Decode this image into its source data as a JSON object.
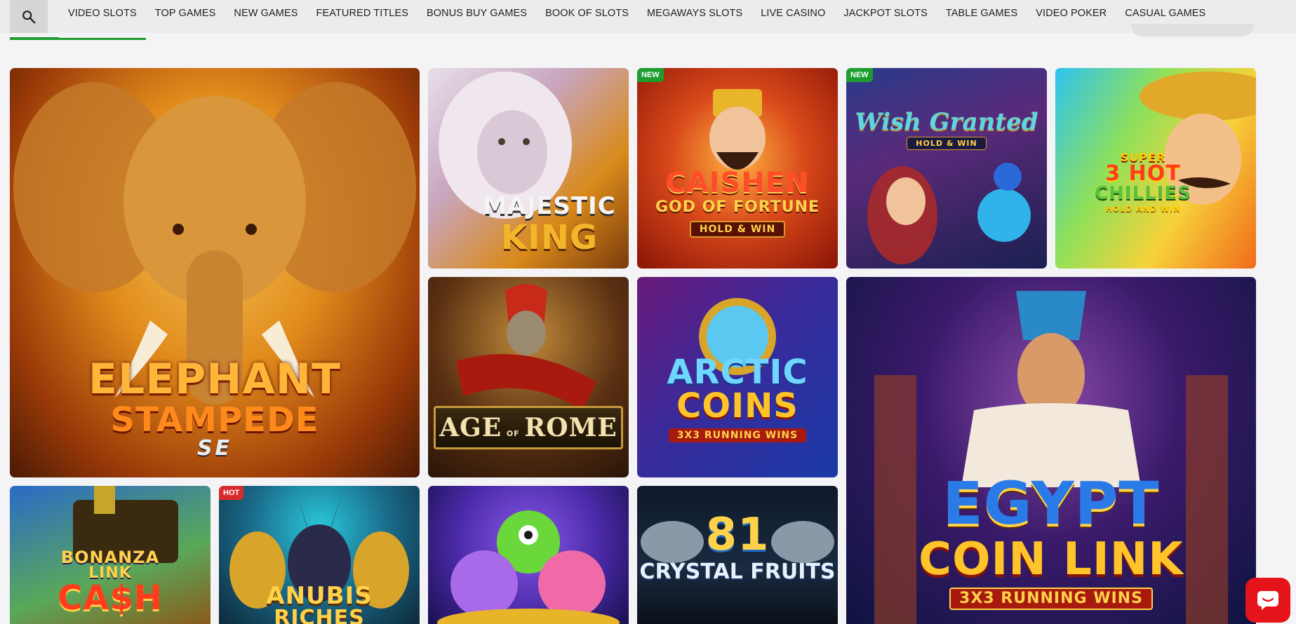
{
  "nav": {
    "tabs": [
      {
        "label": "VIDEO SLOTS",
        "active": true
      },
      {
        "label": "TOP GAMES"
      },
      {
        "label": "NEW GAMES"
      },
      {
        "label": "FEATURED TITLES"
      },
      {
        "label": "BONUS BUY GAMES"
      },
      {
        "label": "BOOK OF SLOTS"
      },
      {
        "label": "MEGAWAYS SLOTS"
      },
      {
        "label": "LIVE CASINO"
      },
      {
        "label": "JACKPOT SLOTS"
      },
      {
        "label": "TABLE GAMES"
      },
      {
        "label": "VIDEO POKER"
      },
      {
        "label": "CASUAL GAMES"
      }
    ],
    "accent_color": "#1c9d2f"
  },
  "games": {
    "elephant": {
      "title_1": "ELEPHANT",
      "title_2": "STAMPEDE",
      "sub": "SE"
    },
    "majestic": {
      "title_1": "MAJESTIC",
      "title_2": "KING"
    },
    "caishen": {
      "badge": "NEW",
      "title_1": "CAISHEN",
      "title_2": "GOD OF FORTUNE",
      "sub": "HOLD & WIN"
    },
    "wish": {
      "badge": "NEW",
      "title_1": "Wish Granted",
      "sub": "HOLD & WIN"
    },
    "chillies": {
      "title_1": "SUPER",
      "title_2": "3 HOT",
      "title_3": "CHILLIES",
      "sub": "HOLD AND WIN"
    },
    "rome": {
      "title_1": "AGE",
      "title_2": "ROME",
      "of": "OF"
    },
    "arctic": {
      "title_1": "ARCTIC",
      "title_2": "COINS",
      "sub": "3X3 RUNNING WINS"
    },
    "egypt": {
      "title_1": "EGYPT",
      "title_2": "COIN LINK",
      "sub": "3X3 RUNNING WINS"
    },
    "bonanza": {
      "title_1": "BONANZA",
      "title_2": "LINK",
      "title_3": "CA$H"
    },
    "anubis": {
      "badge": "HOT",
      "title_1": "ANUBIS",
      "title_2": "RICHES"
    },
    "crystal": {
      "title_1": "81",
      "title_2": "CRYSTAL FRUITS"
    }
  },
  "badge_colors": {
    "new": "#1c9d2f",
    "hot": "#d92b2b"
  },
  "chat": {
    "icon": "chat-icon",
    "color": "#e5131a"
  }
}
